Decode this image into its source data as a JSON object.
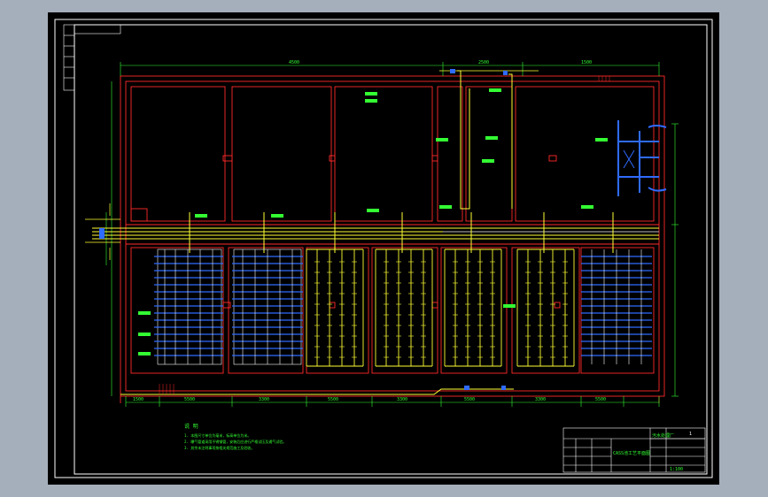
{
  "colors": {
    "window_bg": "#a5aebb",
    "canvas": "#000000",
    "frame": "#ffffff",
    "structure": "#ff2a2a",
    "pipe": "#ffff33",
    "dim": "#33ff33",
    "air": "#2f6bff",
    "cyan_air": "#22d0ff"
  },
  "drawing": {
    "top_dim_total": "4500",
    "top_dim_mid": "2500",
    "top_dim_right": "1500",
    "bottom_dims": [
      "1500",
      "5500",
      "3300",
      "5500",
      "3300",
      "5500",
      "3300",
      "5500",
      "3300",
      "1500"
    ],
    "notes_heading": "说 明",
    "notes": [
      "1. 本图尺寸单位为毫米，标高单位为米。",
      "2. 曝气管道采用不锈钢管，安装后应进行严格试压及通气试验。",
      "3. 其余未注明事项按相关规范施工及验收。"
    ]
  },
  "title_block": {
    "drawing_title": "CASS池工艺平面图",
    "project": "污水处理厂",
    "sheet": "1",
    "scale": "1:100"
  }
}
